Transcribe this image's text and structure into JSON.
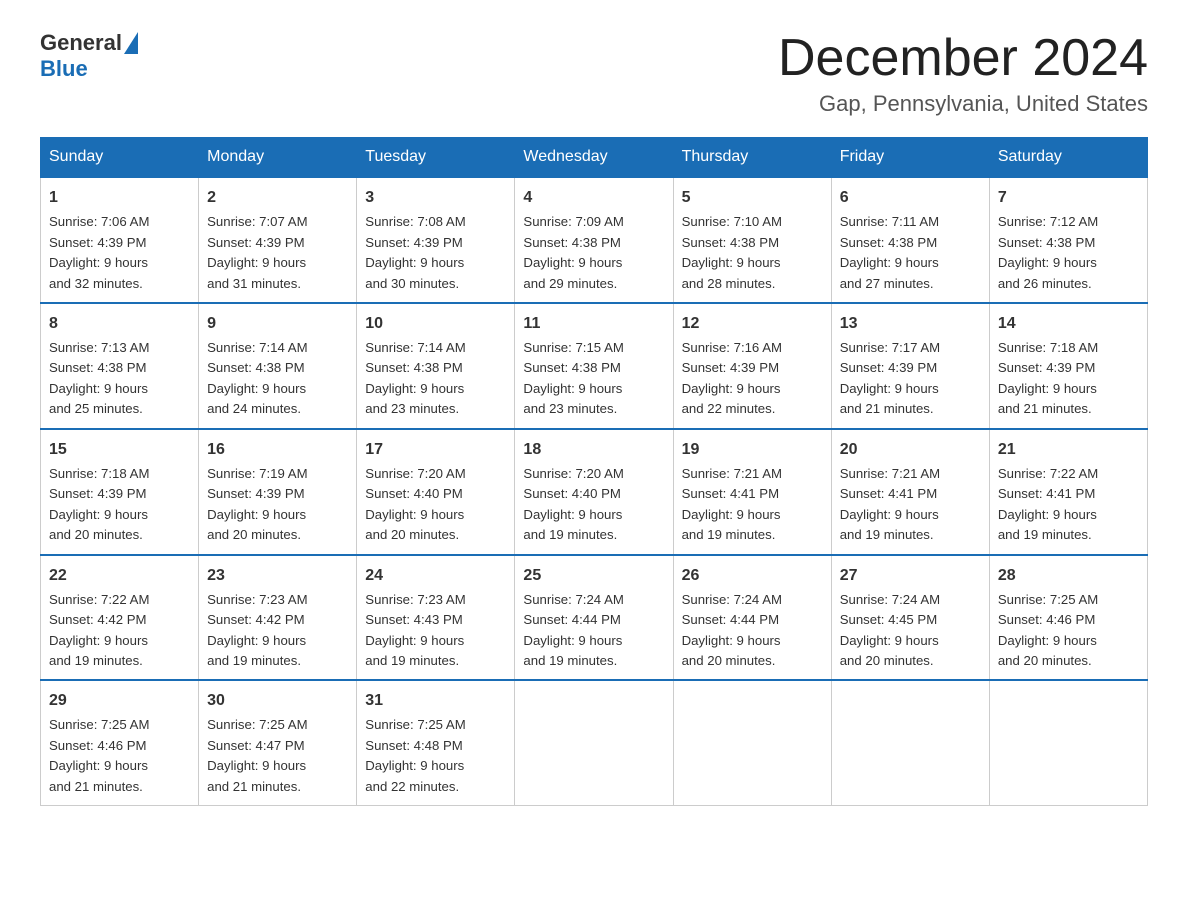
{
  "header": {
    "logo_general": "General",
    "logo_blue": "Blue",
    "title": "December 2024",
    "subtitle": "Gap, Pennsylvania, United States"
  },
  "days_of_week": [
    "Sunday",
    "Monday",
    "Tuesday",
    "Wednesday",
    "Thursday",
    "Friday",
    "Saturday"
  ],
  "weeks": [
    [
      {
        "day": "1",
        "sunrise": "7:06 AM",
        "sunset": "4:39 PM",
        "daylight": "9 hours and 32 minutes."
      },
      {
        "day": "2",
        "sunrise": "7:07 AM",
        "sunset": "4:39 PM",
        "daylight": "9 hours and 31 minutes."
      },
      {
        "day": "3",
        "sunrise": "7:08 AM",
        "sunset": "4:39 PM",
        "daylight": "9 hours and 30 minutes."
      },
      {
        "day": "4",
        "sunrise": "7:09 AM",
        "sunset": "4:38 PM",
        "daylight": "9 hours and 29 minutes."
      },
      {
        "day": "5",
        "sunrise": "7:10 AM",
        "sunset": "4:38 PM",
        "daylight": "9 hours and 28 minutes."
      },
      {
        "day": "6",
        "sunrise": "7:11 AM",
        "sunset": "4:38 PM",
        "daylight": "9 hours and 27 minutes."
      },
      {
        "day": "7",
        "sunrise": "7:12 AM",
        "sunset": "4:38 PM",
        "daylight": "9 hours and 26 minutes."
      }
    ],
    [
      {
        "day": "8",
        "sunrise": "7:13 AM",
        "sunset": "4:38 PM",
        "daylight": "9 hours and 25 minutes."
      },
      {
        "day": "9",
        "sunrise": "7:14 AM",
        "sunset": "4:38 PM",
        "daylight": "9 hours and 24 minutes."
      },
      {
        "day": "10",
        "sunrise": "7:14 AM",
        "sunset": "4:38 PM",
        "daylight": "9 hours and 23 minutes."
      },
      {
        "day": "11",
        "sunrise": "7:15 AM",
        "sunset": "4:38 PM",
        "daylight": "9 hours and 23 minutes."
      },
      {
        "day": "12",
        "sunrise": "7:16 AM",
        "sunset": "4:39 PM",
        "daylight": "9 hours and 22 minutes."
      },
      {
        "day": "13",
        "sunrise": "7:17 AM",
        "sunset": "4:39 PM",
        "daylight": "9 hours and 21 minutes."
      },
      {
        "day": "14",
        "sunrise": "7:18 AM",
        "sunset": "4:39 PM",
        "daylight": "9 hours and 21 minutes."
      }
    ],
    [
      {
        "day": "15",
        "sunrise": "7:18 AM",
        "sunset": "4:39 PM",
        "daylight": "9 hours and 20 minutes."
      },
      {
        "day": "16",
        "sunrise": "7:19 AM",
        "sunset": "4:39 PM",
        "daylight": "9 hours and 20 minutes."
      },
      {
        "day": "17",
        "sunrise": "7:20 AM",
        "sunset": "4:40 PM",
        "daylight": "9 hours and 20 minutes."
      },
      {
        "day": "18",
        "sunrise": "7:20 AM",
        "sunset": "4:40 PM",
        "daylight": "9 hours and 19 minutes."
      },
      {
        "day": "19",
        "sunrise": "7:21 AM",
        "sunset": "4:41 PM",
        "daylight": "9 hours and 19 minutes."
      },
      {
        "day": "20",
        "sunrise": "7:21 AM",
        "sunset": "4:41 PM",
        "daylight": "9 hours and 19 minutes."
      },
      {
        "day": "21",
        "sunrise": "7:22 AM",
        "sunset": "4:41 PM",
        "daylight": "9 hours and 19 minutes."
      }
    ],
    [
      {
        "day": "22",
        "sunrise": "7:22 AM",
        "sunset": "4:42 PM",
        "daylight": "9 hours and 19 minutes."
      },
      {
        "day": "23",
        "sunrise": "7:23 AM",
        "sunset": "4:42 PM",
        "daylight": "9 hours and 19 minutes."
      },
      {
        "day": "24",
        "sunrise": "7:23 AM",
        "sunset": "4:43 PM",
        "daylight": "9 hours and 19 minutes."
      },
      {
        "day": "25",
        "sunrise": "7:24 AM",
        "sunset": "4:44 PM",
        "daylight": "9 hours and 19 minutes."
      },
      {
        "day": "26",
        "sunrise": "7:24 AM",
        "sunset": "4:44 PM",
        "daylight": "9 hours and 20 minutes."
      },
      {
        "day": "27",
        "sunrise": "7:24 AM",
        "sunset": "4:45 PM",
        "daylight": "9 hours and 20 minutes."
      },
      {
        "day": "28",
        "sunrise": "7:25 AM",
        "sunset": "4:46 PM",
        "daylight": "9 hours and 20 minutes."
      }
    ],
    [
      {
        "day": "29",
        "sunrise": "7:25 AM",
        "sunset": "4:46 PM",
        "daylight": "9 hours and 21 minutes."
      },
      {
        "day": "30",
        "sunrise": "7:25 AM",
        "sunset": "4:47 PM",
        "daylight": "9 hours and 21 minutes."
      },
      {
        "day": "31",
        "sunrise": "7:25 AM",
        "sunset": "4:48 PM",
        "daylight": "9 hours and 22 minutes."
      },
      null,
      null,
      null,
      null
    ]
  ],
  "labels": {
    "sunrise": "Sunrise:",
    "sunset": "Sunset:",
    "daylight": "Daylight:"
  }
}
